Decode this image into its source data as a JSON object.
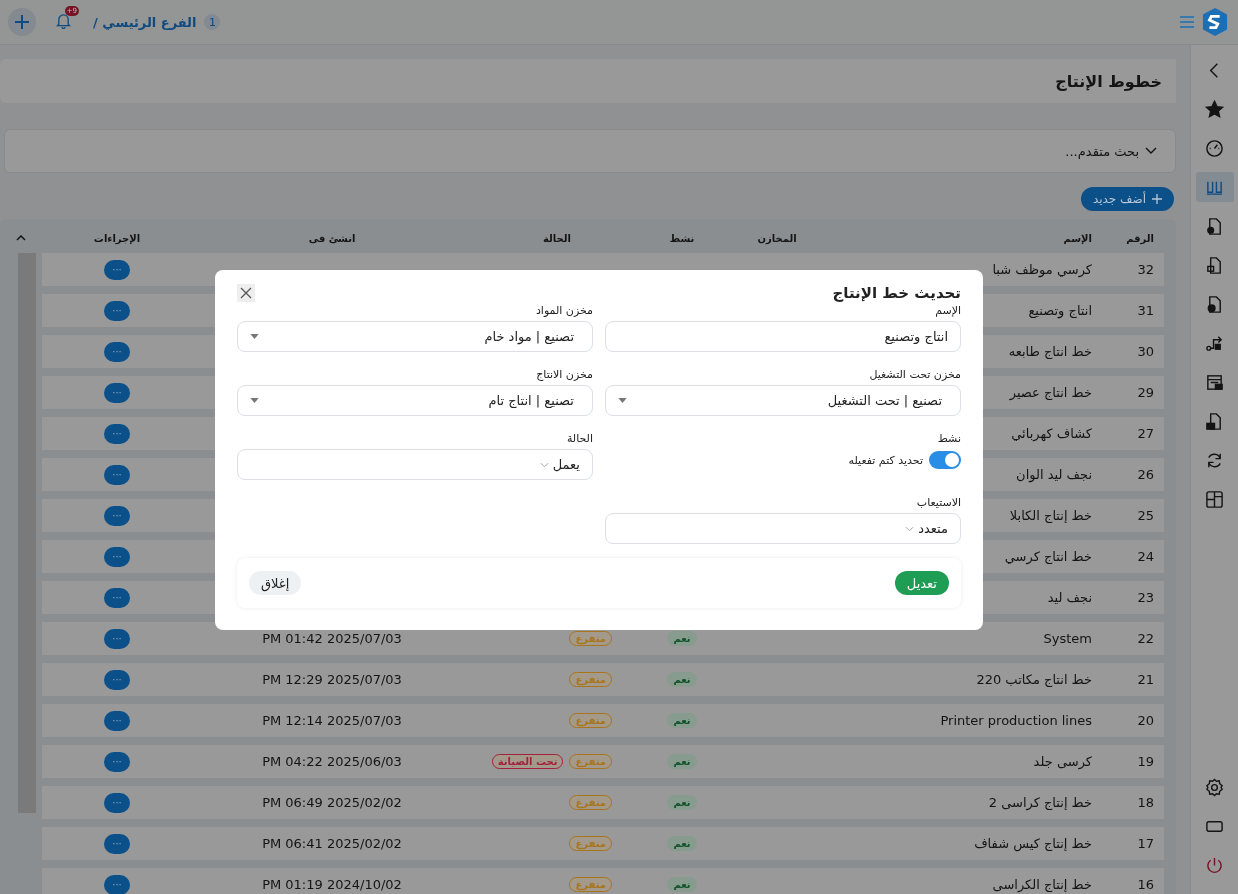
{
  "topbar": {
    "branch_count": "1",
    "branch": "الفرع الرئيسي /",
    "notifications": "+9"
  },
  "sidebar": {
    "items": [
      {
        "selected": false
      },
      {
        "selected": false
      },
      {
        "selected": false
      },
      {
        "selected": true
      },
      {
        "selected": false
      },
      {
        "selected": false
      },
      {
        "selected": false
      },
      {
        "selected": false
      },
      {
        "selected": false
      },
      {
        "selected": false
      },
      {
        "selected": false
      },
      {
        "selected": false
      }
    ],
    "bottom": [
      {
        "selected": false
      },
      {
        "selected": false
      },
      {
        "selected": false
      }
    ]
  },
  "page": {
    "title": "خطوط الإنتاج",
    "advanced_search": "بحث متقدم...",
    "add_button": "أضف جديد"
  },
  "table": {
    "columns": [
      "الرقم",
      "الإسم",
      "المخازن",
      "نشط",
      "الحالة",
      "انشئ فى",
      "الإجراءات"
    ],
    "rows": [
      {
        "number": "32",
        "name": "كرسي موظف شبا",
        "action": "···"
      },
      {
        "number": "31",
        "name": "انتاج وتصنيع",
        "action": "···"
      },
      {
        "number": "30",
        "name": "خط انتاج طابعه",
        "action": "···"
      },
      {
        "number": "29",
        "name": "خط انتاج عصير",
        "action": "···"
      },
      {
        "number": "27",
        "name": "كشاف كهربائي",
        "action": "···"
      },
      {
        "number": "26",
        "name": "نجف ليد الوان",
        "action": "···"
      },
      {
        "number": "25",
        "name": "خط إنتاج الكابلا",
        "action": "···"
      },
      {
        "number": "24",
        "name": "خط انتاج كرسي",
        "action": "···"
      },
      {
        "number": "23",
        "name": "نجف ليد",
        "action": "···"
      },
      {
        "number": "22",
        "name": "System",
        "active": "نعم",
        "statuses": [
          {
            "label": "متفرغ",
            "color": "#a8751c"
          }
        ],
        "created": "2025/07/03 01:42 PM",
        "action": "···"
      },
      {
        "number": "21",
        "name": "خط انتاج مكاتب 220",
        "active": "نعم",
        "statuses": [
          {
            "label": "متفرغ",
            "color": "#a8751c"
          }
        ],
        "created": "2025/07/03 12:29 PM",
        "action": "···"
      },
      {
        "number": "20",
        "name": "Printer production lines",
        "active": "نعم",
        "statuses": [
          {
            "label": "متفرغ",
            "color": "#a8751c"
          }
        ],
        "created": "2025/07/03 12:14 PM",
        "action": "···"
      },
      {
        "number": "19",
        "name": "كرسى جلد",
        "active": "نعم",
        "statuses": [
          {
            "label": "متفرغ",
            "color": "#a8751c"
          },
          {
            "label": "تحت الصيانة",
            "color": "#a3213e"
          }
        ],
        "created": "2025/06/03 04:22 PM",
        "action": "···"
      },
      {
        "number": "18",
        "name": "خط إنتاج كراسى 2",
        "active": "نعم",
        "statuses": [
          {
            "label": "متفرغ",
            "color": "#a8751c"
          }
        ],
        "created": "2025/02/02 06:49 PM",
        "action": "···"
      },
      {
        "number": "17",
        "name": "خط إنتاج كيس شفاف",
        "active": "نعم",
        "statuses": [
          {
            "label": "متفرغ",
            "color": "#a8751c"
          }
        ],
        "created": "2025/02/02 06:41 PM",
        "action": "···"
      },
      {
        "number": "16",
        "name": "خط إنتاج الكراسى",
        "active": "نعم",
        "statuses": [
          {
            "label": "متفرغ",
            "color": "#a8751c"
          }
        ],
        "created": "2024/10/02 01:19 PM",
        "action": "···"
      }
    ]
  },
  "modal": {
    "title": "تحديث خط الإنتاج",
    "fields": [
      {
        "kind": "text",
        "label": "الإسم",
        "value": "انتاج وتصنيع"
      },
      {
        "kind": "select",
        "label": "مخزن المواد",
        "value": "تصنيع | مواد خام"
      },
      {
        "kind": "select",
        "label": "مخزن تحت التشغيل",
        "value": "تصنيع | تحت التشغيل"
      },
      {
        "kind": "select",
        "label": "مخزن الانتاج",
        "value": "تصنيع | انتاج تام"
      },
      {
        "kind": "toggle",
        "label": "نشط",
        "on": true,
        "text": "تحديد كتم تفعيله"
      },
      {
        "kind": "picker",
        "label": "الحالة",
        "value": "يعمل"
      },
      {
        "kind": "picker",
        "label": "الاستيعاب",
        "value": "متعدد"
      }
    ],
    "submit": "تعديل",
    "close": "إغلاق"
  }
}
